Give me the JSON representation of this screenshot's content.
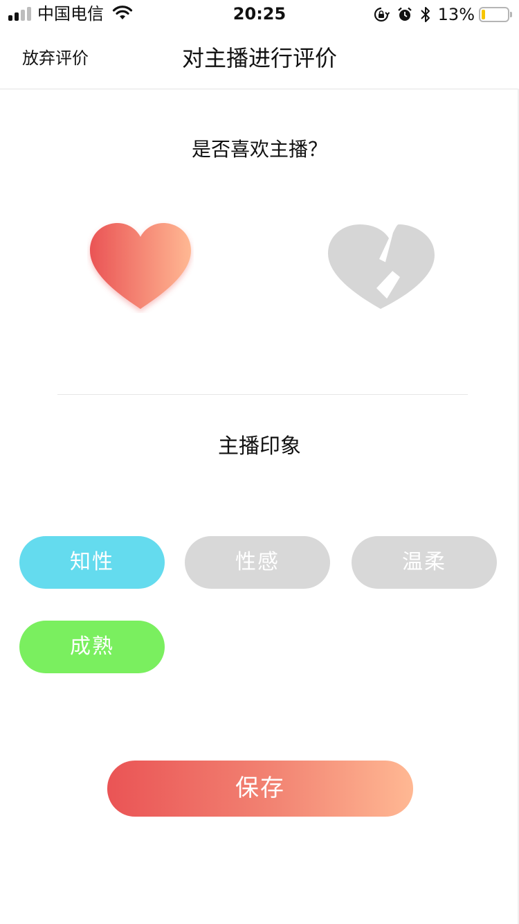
{
  "status_bar": {
    "carrier": "中国电信",
    "time": "20:25",
    "battery_percent": "13%",
    "battery_level": 0.13,
    "icons": [
      "signal-icon",
      "wifi-icon",
      "orientation-lock-icon",
      "alarm-icon",
      "bluetooth-icon",
      "battery-icon"
    ]
  },
  "nav": {
    "left_button": "放弃评价",
    "title": "对主播进行评价"
  },
  "rating": {
    "question": "是否喜欢主播？",
    "like_icon": "heart-icon",
    "dislike_icon": "broken-heart-icon",
    "selected": "like"
  },
  "impression": {
    "title": "主播印象",
    "tags": [
      {
        "label": "知性",
        "selected": true,
        "color": "#64dbee"
      },
      {
        "label": "性感",
        "selected": false,
        "color": "#d8d8d8"
      },
      {
        "label": "温柔",
        "selected": false,
        "color": "#d8d8d8"
      },
      {
        "label": "成熟",
        "selected": true,
        "color": "#7aef5f"
      }
    ]
  },
  "save_button": {
    "label": "保存"
  },
  "colors": {
    "gradient_start": "#ea5455",
    "gradient_end": "#ffb893",
    "inactive_gray": "#d8d8d8"
  }
}
